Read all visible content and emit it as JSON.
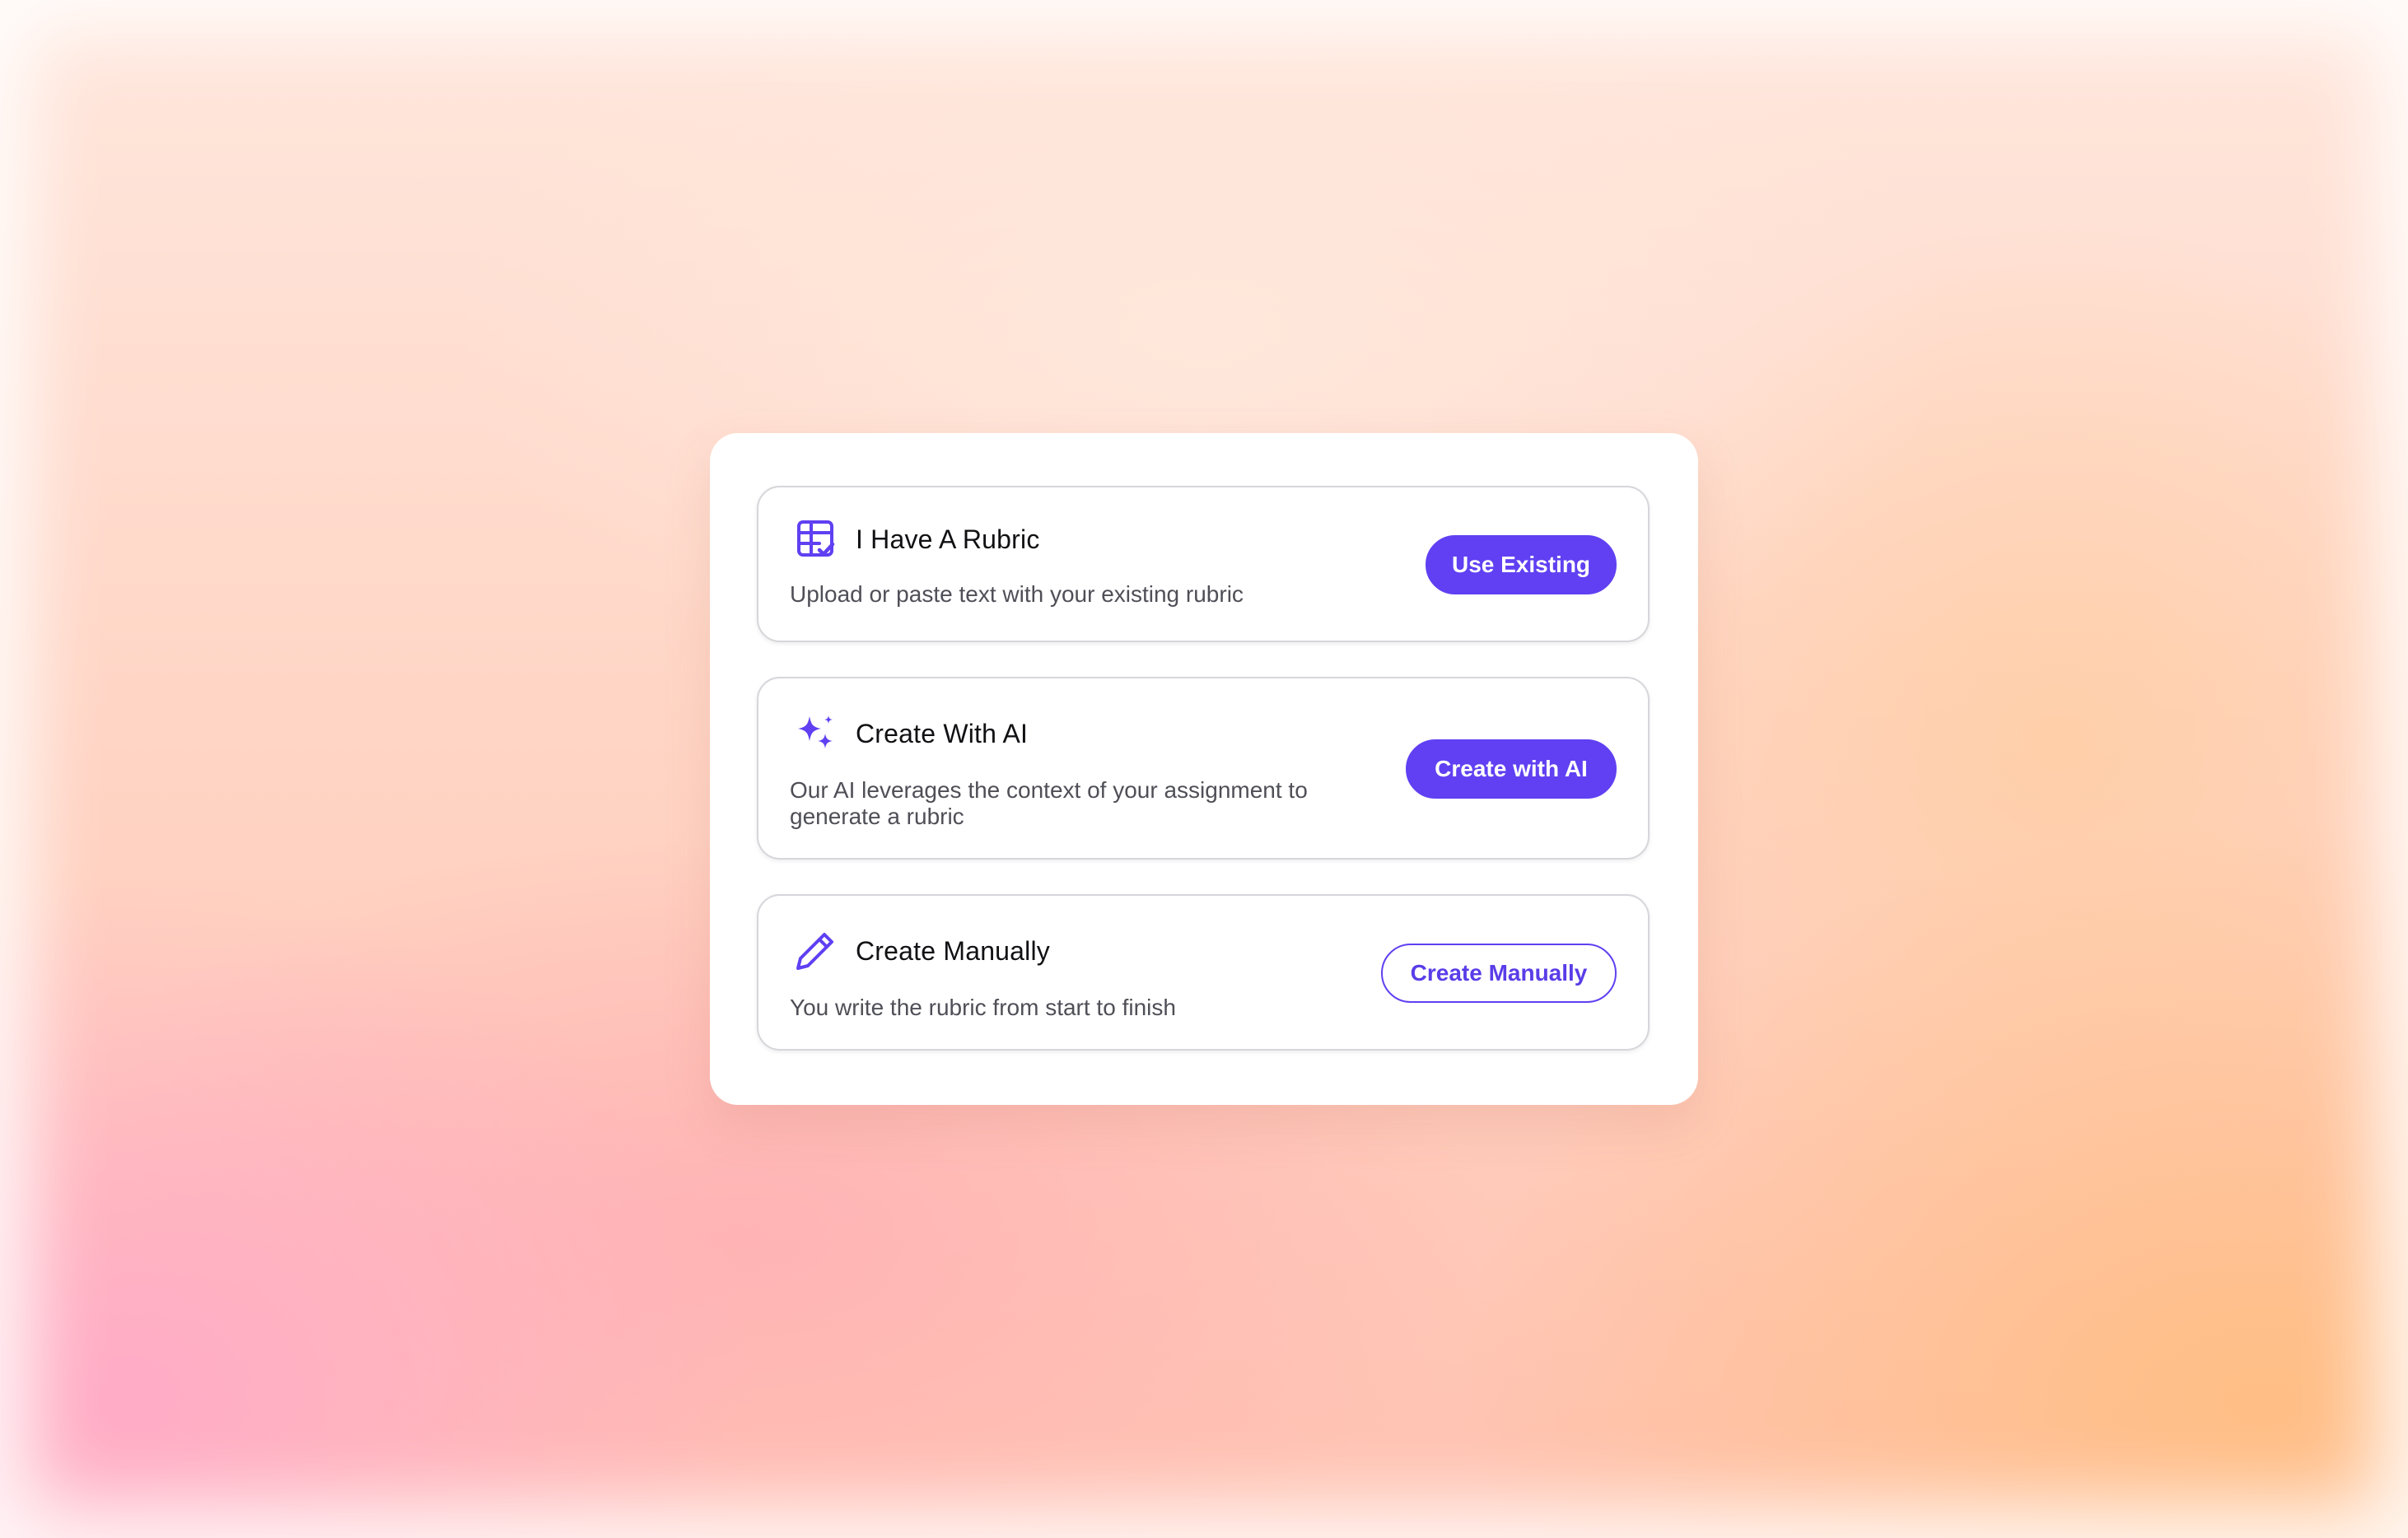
{
  "colors": {
    "accent": "#6040f2",
    "card_border": "#d6d6db",
    "title_text": "#111114",
    "description_text": "#4f4f57"
  },
  "options": [
    {
      "icon": "rubric-checklist-icon",
      "title": "I Have A Rubric",
      "description": "Upload or paste text with your existing rubric",
      "button_label": "Use Existing",
      "button_style": "solid"
    },
    {
      "icon": "sparkles-icon",
      "title": "Create With AI",
      "description": "Our AI leverages the context of your assignment to generate a rubric",
      "button_label": "Create with AI",
      "button_style": "solid"
    },
    {
      "icon": "pencil-icon",
      "title": "Create Manually",
      "description": "You write the rubric from start to finish",
      "button_label": "Create Manually",
      "button_style": "outline"
    }
  ]
}
